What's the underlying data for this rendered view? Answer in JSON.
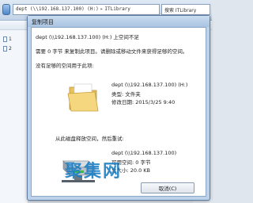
{
  "explorer": {
    "address": {
      "segments": [
        "dept (\\\\192.168.137.100) (H:)",
        "ITLibrary"
      ]
    },
    "search": {
      "text": "搜索 ITLibrary"
    },
    "left_pane": {
      "items": [
        "1",
        "2"
      ]
    }
  },
  "dialog": {
    "title": "复制项目",
    "message_path": "dept (\\\\192.168.137.100) (H:) 上空间不足",
    "message_detail": "需要 0 字节 来复制此项目。请删除或移动文件来获得足够的空间。",
    "no_space_label": "没有足够的空间用于此项:",
    "item": {
      "name": "dept (\\\\192.168.137.100) (H:)",
      "type": "类型: 文件夹",
      "modified": "修改日期: 2015/3/25 9:40"
    },
    "free_space_prompt": "从此磁盘释放空间，然后重试:",
    "drive": {
      "name": "dept (\\\\192.168.137.100)",
      "available": "可用空间: 0 字节",
      "total": "总大小: 20.0 KB"
    },
    "cancel_label": "取消(C)"
  },
  "watermark": "聚集网",
  "colors": {
    "accent": "#1c7fc4",
    "dialog_frame": "#bcd2ea"
  }
}
